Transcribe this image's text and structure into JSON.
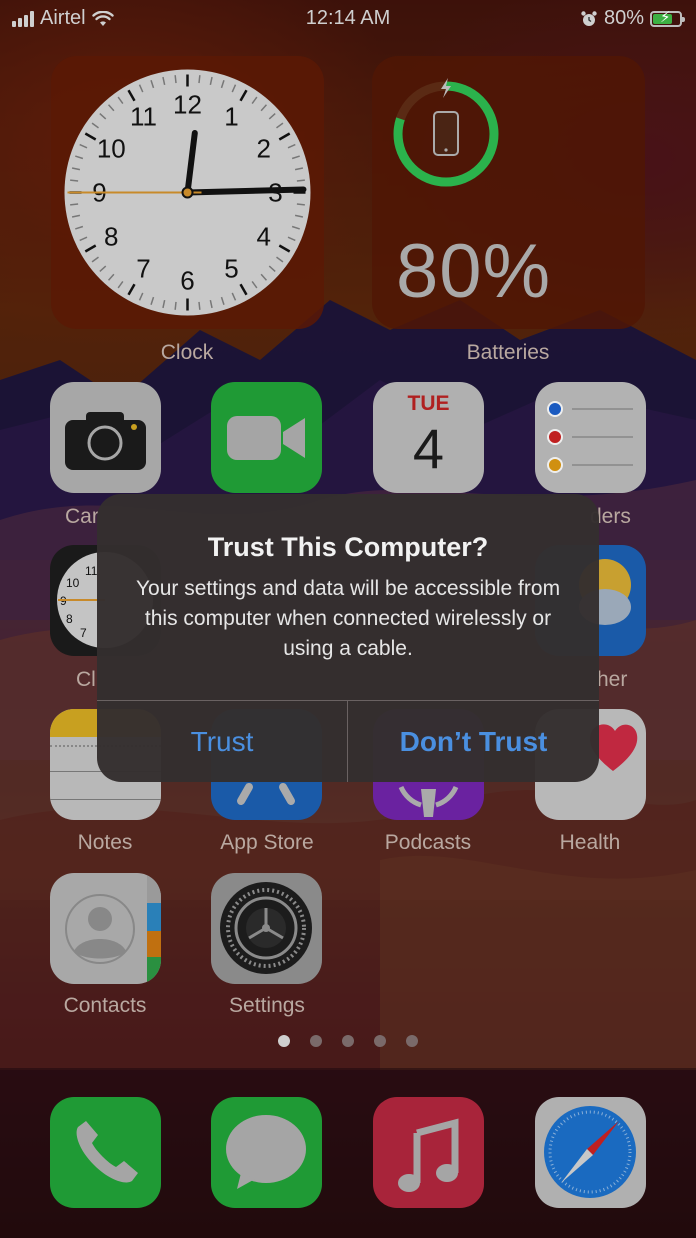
{
  "status_bar": {
    "carrier": "Airtel",
    "time": "12:14 AM",
    "battery_percent": "80%",
    "battery_level": 0.8,
    "icons": [
      "signal-icon",
      "wifi-icon",
      "alarm-icon",
      "battery-charging-icon"
    ]
  },
  "widgets": {
    "clock": {
      "label": "Clock",
      "numbers": [
        "12",
        "1",
        "2",
        "3",
        "4",
        "5",
        "6",
        "7",
        "8",
        "9",
        "10",
        "11"
      ],
      "time_shown": "12:14:45"
    },
    "batteries": {
      "label": "Batteries",
      "percent": "80%",
      "level": 0.8,
      "ring_color": "#2bb24c"
    }
  },
  "apps": [
    {
      "name": "Camera",
      "label": "Camera",
      "visible_label": "Car"
    },
    {
      "name": "FaceTime",
      "label": "FaceTime"
    },
    {
      "name": "Calendar",
      "label": "Calendar",
      "day": "TUE",
      "date": "4"
    },
    {
      "name": "Reminders",
      "label": "Reminders",
      "visible_label": "ders"
    },
    {
      "name": "Clock",
      "label": "Clock",
      "visible_label": "Cl"
    },
    {
      "name": "Weather",
      "label": "Weather",
      "visible_label": "her"
    },
    {
      "name": "Notes",
      "label": "Notes"
    },
    {
      "name": "App Store",
      "label": "App Store"
    },
    {
      "name": "Podcasts",
      "label": "Podcasts"
    },
    {
      "name": "Health",
      "label": "Health"
    },
    {
      "name": "Contacts",
      "label": "Contacts"
    },
    {
      "name": "Settings",
      "label": "Settings"
    }
  ],
  "page_dots": {
    "count": 5,
    "active": 0
  },
  "dock": [
    {
      "name": "Phone"
    },
    {
      "name": "Messages"
    },
    {
      "name": "Music"
    },
    {
      "name": "Safari"
    }
  ],
  "alert": {
    "title": "Trust This Computer?",
    "message": "Your settings and data will be accessible from this computer when connected wirelessly or using a cable.",
    "buttons": {
      "trust": "Trust",
      "dont_trust": "Don’t Trust"
    },
    "button_color": "#4a8fe0"
  }
}
